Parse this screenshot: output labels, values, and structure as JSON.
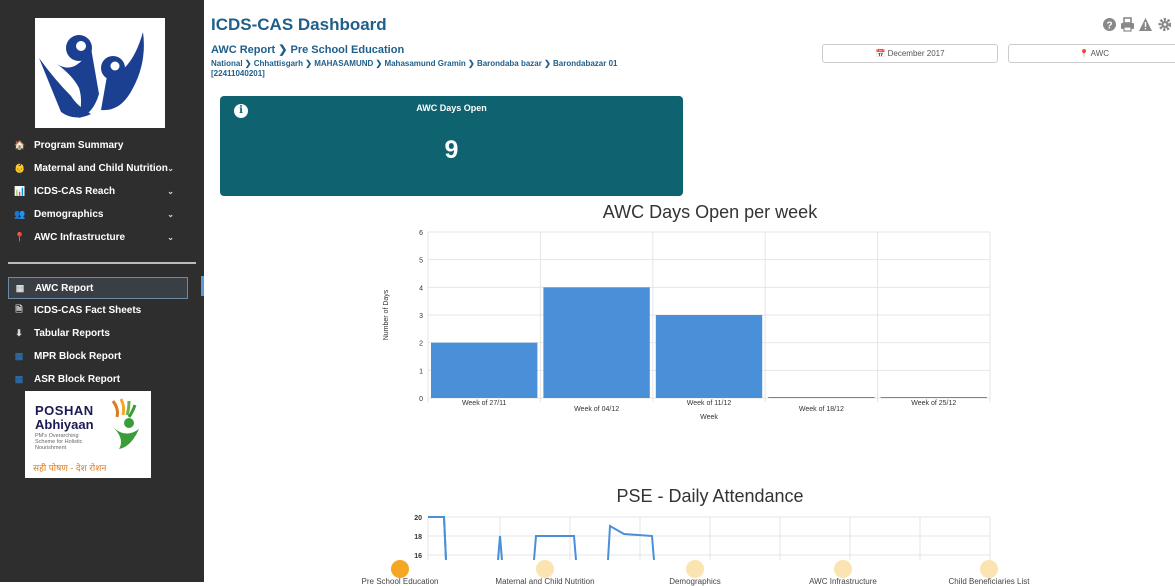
{
  "header": {
    "title": "ICDS-CAS Dashboard",
    "icons": [
      "question-circle-icon",
      "print-icon",
      "warning-icon",
      "gear-icon"
    ]
  },
  "report": {
    "title": "AWC Report ❯ Pre School Education",
    "breadcrumb": "National ❯ Chhattisgarh ❯ MAHASAMUND ❯ Mahasamund Gramin ❯ Barondaba bazar ❯ Barondabazar 01 [22411040201]"
  },
  "filters": {
    "date": "📅 December 2017",
    "location": "📍 AWC"
  },
  "sidebar": {
    "items": [
      {
        "label": "Program Summary",
        "icon": "home-icon",
        "glyph": "🏠"
      },
      {
        "label": "Maternal and Child Nutrition",
        "icon": "child-icon",
        "glyph": "👶",
        "chevron": "⌄"
      },
      {
        "label": "ICDS-CAS Reach",
        "icon": "bar-chart-icon",
        "glyph": "📊",
        "chevron": "⌄"
      },
      {
        "label": "Demographics",
        "icon": "users-icon",
        "glyph": "👥",
        "chevron": "⌄"
      },
      {
        "label": "AWC Infrastructure",
        "icon": "map-marker-icon",
        "glyph": "📍",
        "chevron": "⌄"
      }
    ],
    "reports": [
      {
        "label": "AWC Report",
        "icon": "table-icon",
        "glyph": "▦"
      },
      {
        "label": "ICDS-CAS Fact Sheets",
        "icon": "file-icon",
        "glyph": "🗎"
      },
      {
        "label": "Tabular Reports",
        "icon": "download-icon",
        "glyph": "⬇"
      },
      {
        "label": "MPR Block Report",
        "icon": "table-icon",
        "glyph": "▦"
      },
      {
        "label": "ASR Block Report",
        "icon": "table-icon",
        "glyph": "▦"
      }
    ],
    "poshan": {
      "line1": "POSHAN",
      "line2": "Abhiyaan",
      "tagline": "PM's Overarching Scheme for Holistic Nourishment",
      "hindi": "सही पोषण - देश रोशन"
    }
  },
  "kpi": {
    "label": "AWC Days Open",
    "value": "9"
  },
  "chart_data": [
    {
      "type": "bar",
      "title": "AWC Days Open per week",
      "xlabel": "Week",
      "ylabel": "Number of Days",
      "categories": [
        "Week of 27/11",
        "Week of 04/12",
        "Week of 11/12",
        "Week of 18/12",
        "Week of 25/12"
      ],
      "values": [
        2,
        4,
        3,
        0,
        0
      ],
      "ylim": [
        0,
        6
      ],
      "yticks": [
        0,
        1,
        2,
        3,
        4,
        5,
        6
      ],
      "color": "#4a90d9",
      "grid": true
    },
    {
      "type": "line",
      "title": "PSE - Daily Attendance",
      "yticks_visible": [
        16,
        18,
        20
      ],
      "color": "#4a90d9",
      "grid": true
    }
  ],
  "bottom_nav": [
    {
      "label": "Pre School Education",
      "active": true
    },
    {
      "label": "Maternal and Child Nutrition",
      "active": false
    },
    {
      "label": "Demographics",
      "active": false
    },
    {
      "label": "AWC Infrastructure",
      "active": false
    },
    {
      "label": "Child Beneficiaries List",
      "active": false
    }
  ],
  "colors": {
    "sidebar_bg": "#2e2e2e",
    "kpi_bg": "#0f6270",
    "accent": "#1f5f8b",
    "bar": "#4a90d9",
    "bottom_active": "#f5a623",
    "bottom_inactive": "#fbe3b2"
  }
}
